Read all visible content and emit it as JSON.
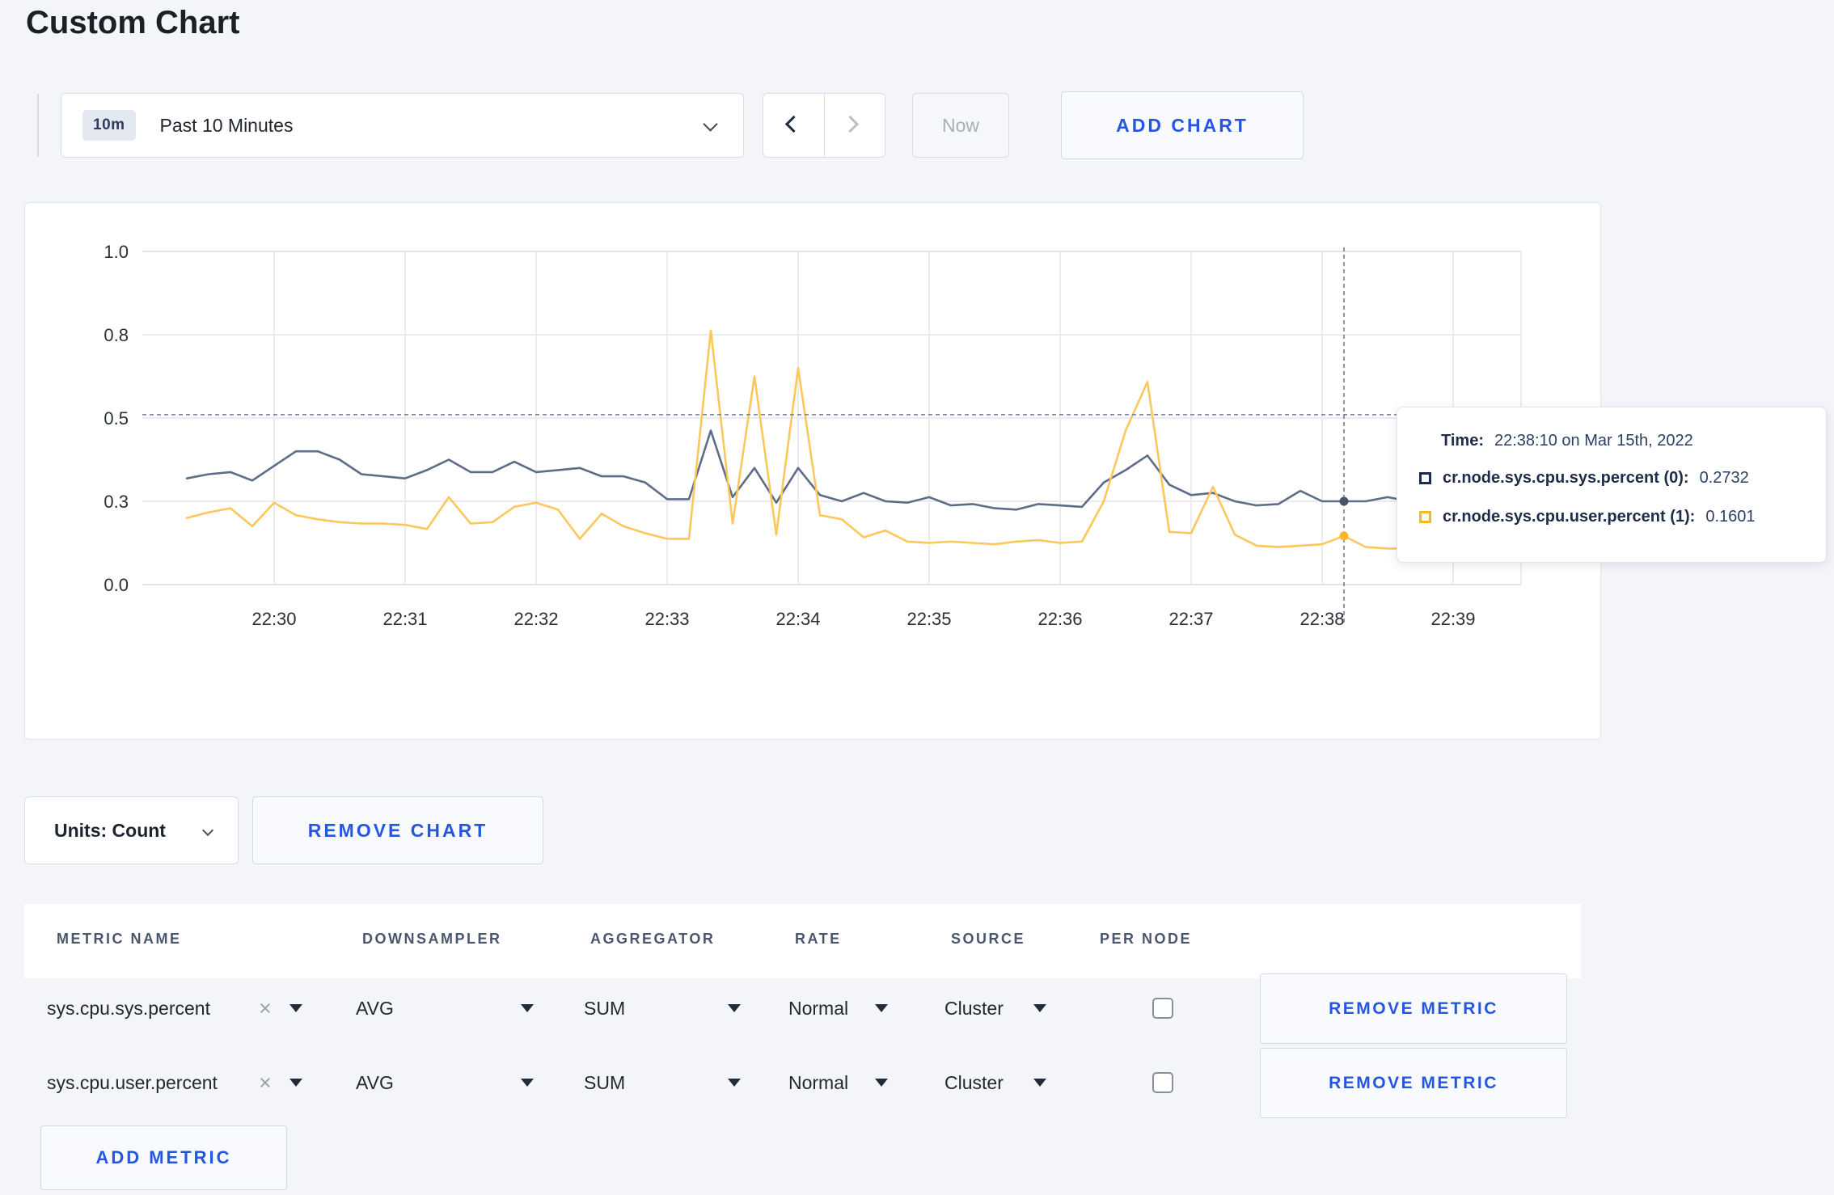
{
  "page": {
    "title": "Custom Chart"
  },
  "colors": {
    "accent_blue": "#2456e0",
    "series_sys": "#5e6d87",
    "series_user": "#fcc75b",
    "dot_sys": "#46536b",
    "dot_user": "#fdb827",
    "grid": "#ececf0",
    "axis_text": "#2b3038",
    "crosshair": "#6e7f96"
  },
  "toolbar": {
    "time_badge": "10m",
    "time_label": "Past 10 Minutes",
    "now_label": "Now",
    "add_chart_label": "ADD CHART"
  },
  "chart_controls": {
    "units_label": "Units: Count",
    "remove_chart_label": "REMOVE CHART"
  },
  "tooltip": {
    "time_label": "Time:",
    "time_value": "22:38:10 on Mar 15th, 2022",
    "rows": [
      {
        "name": "cr.node.sys.cpu.sys.percent (0):",
        "value": "0.2732"
      },
      {
        "name": "cr.node.sys.cpu.user.percent (1):",
        "value": "0.1601"
      }
    ]
  },
  "chart_data": {
    "type": "line",
    "title": "",
    "x_start": "22:29:20",
    "x_interval_seconds": 10,
    "x_axis_ticks": [
      "22:30",
      "22:31",
      "22:32",
      "22:33",
      "22:34",
      "22:35",
      "22:36",
      "22:37",
      "22:38",
      "22:39"
    ],
    "y_axis_ticks": [
      0.0,
      0.3,
      0.5,
      0.8,
      1.0
    ],
    "ylim": [
      0,
      1
    ],
    "grid": true,
    "crosshair": {
      "point_index": 53,
      "time": "22:38:10",
      "hover_value": 0.512
    },
    "series": [
      {
        "name": "cr.node.sys.cpu.sys.percent",
        "values": [
          0.355,
          0.365,
          0.37,
          0.35,
          0.385,
          0.42,
          0.42,
          0.4,
          0.365,
          0.36,
          0.355,
          0.375,
          0.4,
          0.37,
          0.37,
          0.395,
          0.37,
          0.375,
          0.38,
          0.36,
          0.36,
          0.345,
          0.305,
          0.305,
          0.47,
          0.31,
          0.38,
          0.295,
          0.38,
          0.315,
          0.3,
          0.32,
          0.3,
          0.295,
          0.31,
          0.285,
          0.29,
          0.275,
          0.27,
          0.29,
          0.285,
          0.28,
          0.345,
          0.375,
          0.41,
          0.34,
          0.315,
          0.32,
          0.3,
          0.285,
          0.29,
          0.325,
          0.3,
          0.3,
          0.3,
          0.31,
          0.3,
          0.305,
          0.31,
          0.3,
          0.305
        ]
      },
      {
        "name": "cr.node.sys.cpu.user.percent",
        "values": [
          0.24,
          0.26,
          0.275,
          0.21,
          0.295,
          0.25,
          0.235,
          0.225,
          0.22,
          0.22,
          0.215,
          0.2,
          0.31,
          0.22,
          0.225,
          0.28,
          0.295,
          0.27,
          0.165,
          0.255,
          0.21,
          0.185,
          0.165,
          0.165,
          0.81,
          0.22,
          0.65,
          0.18,
          0.68,
          0.25,
          0.235,
          0.17,
          0.195,
          0.155,
          0.15,
          0.155,
          0.15,
          0.145,
          0.155,
          0.16,
          0.15,
          0.155,
          0.3,
          0.47,
          0.63,
          0.19,
          0.185,
          0.335,
          0.18,
          0.14,
          0.135,
          0.14,
          0.145,
          0.175,
          0.135,
          0.13,
          0.13,
          0.155,
          0.27,
          0.25,
          0.215
        ]
      }
    ]
  },
  "metrics_table": {
    "headers": [
      "METRIC NAME",
      "DOWNSAMPLER",
      "AGGREGATOR",
      "RATE",
      "SOURCE",
      "PER NODE"
    ],
    "rows": [
      {
        "metric_name": "sys.cpu.sys.percent",
        "downsampler": "AVG",
        "aggregator": "SUM",
        "rate": "Normal",
        "source": "Cluster",
        "per_node_checked": false,
        "remove_label": "REMOVE METRIC"
      },
      {
        "metric_name": "sys.cpu.user.percent",
        "downsampler": "AVG",
        "aggregator": "SUM",
        "rate": "Normal",
        "source": "Cluster",
        "per_node_checked": false,
        "remove_label": "REMOVE METRIC"
      }
    ],
    "add_metric_label": "ADD METRIC"
  }
}
